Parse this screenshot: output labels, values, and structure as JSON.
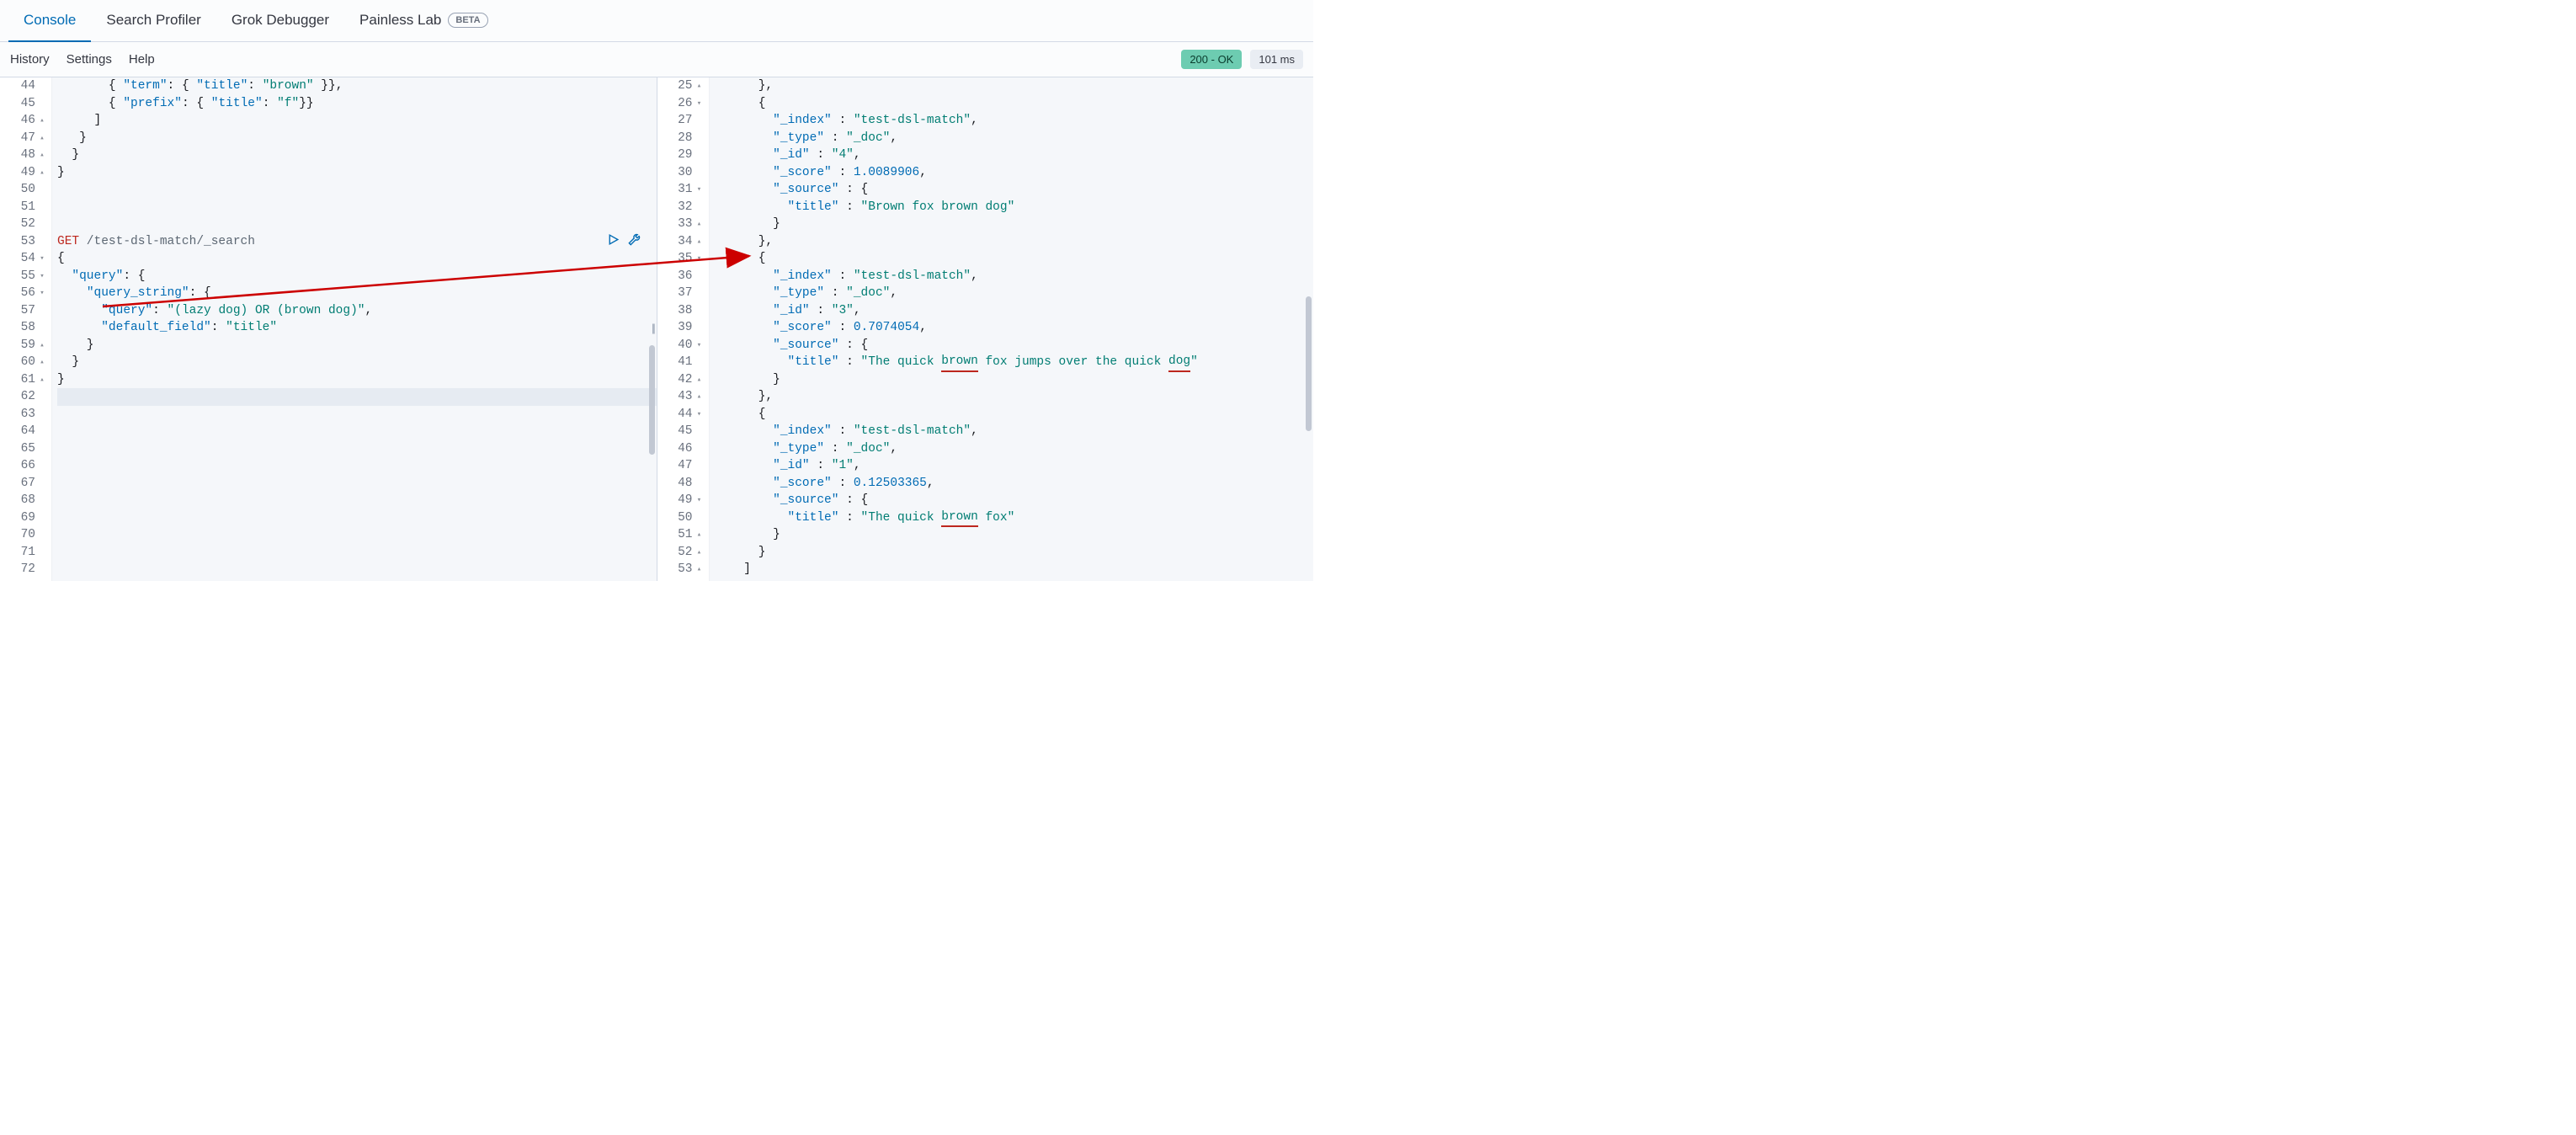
{
  "tabs": {
    "console": "Console",
    "search_profiler": "Search Profiler",
    "grok_debugger": "Grok Debugger",
    "painless_lab": "Painless Lab",
    "beta": "BETA"
  },
  "subbar": {
    "history": "History",
    "settings": "Settings",
    "help": "Help",
    "status": "200 - OK",
    "time": "101 ms"
  },
  "left": {
    "lines": [
      {
        "n": 44,
        "f": "",
        "seg": [
          {
            "t": "       { ",
            "c": "k-punc"
          },
          {
            "t": "\"term\"",
            "c": "k-key"
          },
          {
            "t": ": { ",
            "c": "k-punc"
          },
          {
            "t": "\"title\"",
            "c": "k-key"
          },
          {
            "t": ": ",
            "c": "k-punc"
          },
          {
            "t": "\"brown\"",
            "c": "k-str"
          },
          {
            "t": " }},",
            "c": "k-punc"
          }
        ]
      },
      {
        "n": 45,
        "f": "",
        "seg": [
          {
            "t": "       { ",
            "c": "k-punc"
          },
          {
            "t": "\"prefix\"",
            "c": "k-key"
          },
          {
            "t": ": { ",
            "c": "k-punc"
          },
          {
            "t": "\"title\"",
            "c": "k-key"
          },
          {
            "t": ": ",
            "c": "k-punc"
          },
          {
            "t": "\"f\"",
            "c": "k-str"
          },
          {
            "t": "}}",
            "c": "k-punc"
          }
        ]
      },
      {
        "n": 46,
        "f": "▴",
        "seg": [
          {
            "t": "     ]",
            "c": "k-punc"
          }
        ]
      },
      {
        "n": 47,
        "f": "▴",
        "seg": [
          {
            "t": "   }",
            "c": "k-punc"
          }
        ]
      },
      {
        "n": 48,
        "f": "▴",
        "seg": [
          {
            "t": "  }",
            "c": "k-punc"
          }
        ]
      },
      {
        "n": 49,
        "f": "▴",
        "seg": [
          {
            "t": "}",
            "c": "k-punc"
          }
        ]
      },
      {
        "n": 50,
        "f": "",
        "seg": []
      },
      {
        "n": 51,
        "f": "",
        "seg": []
      },
      {
        "n": 52,
        "f": "",
        "seg": []
      },
      {
        "n": 53,
        "f": "",
        "seg": [
          {
            "t": "GET",
            "c": "k-method"
          },
          {
            "t": " /test-dsl-match/_search",
            "c": "k-path"
          }
        ]
      },
      {
        "n": 54,
        "f": "▾",
        "seg": [
          {
            "t": "{",
            "c": "k-punc"
          }
        ]
      },
      {
        "n": 55,
        "f": "▾",
        "seg": [
          {
            "t": "  ",
            "c": ""
          },
          {
            "t": "\"query\"",
            "c": "k-key"
          },
          {
            "t": ": {",
            "c": "k-punc"
          }
        ]
      },
      {
        "n": 56,
        "f": "▾",
        "seg": [
          {
            "t": "    ",
            "c": ""
          },
          {
            "t": "\"query_string\"",
            "c": "k-key"
          },
          {
            "t": ": {",
            "c": "k-punc"
          }
        ]
      },
      {
        "n": 57,
        "f": "",
        "seg": [
          {
            "t": "      ",
            "c": ""
          },
          {
            "t": "\"query\"",
            "c": "k-key"
          },
          {
            "t": ": ",
            "c": "k-punc"
          },
          {
            "t": "\"(lazy dog) OR (brown dog)\"",
            "c": "k-str"
          },
          {
            "t": ",",
            "c": "k-punc"
          }
        ]
      },
      {
        "n": 58,
        "f": "",
        "seg": [
          {
            "t": "      ",
            "c": ""
          },
          {
            "t": "\"default_field\"",
            "c": "k-key"
          },
          {
            "t": ": ",
            "c": "k-punc"
          },
          {
            "t": "\"title\"",
            "c": "k-str"
          }
        ]
      },
      {
        "n": 59,
        "f": "▴",
        "seg": [
          {
            "t": "    }",
            "c": "k-punc"
          }
        ]
      },
      {
        "n": 60,
        "f": "▴",
        "seg": [
          {
            "t": "  }",
            "c": "k-punc"
          }
        ]
      },
      {
        "n": 61,
        "f": "▴",
        "seg": [
          {
            "t": "}",
            "c": "k-punc"
          }
        ]
      },
      {
        "n": 62,
        "f": "",
        "hl": true,
        "seg": []
      },
      {
        "n": 63,
        "f": "",
        "seg": []
      },
      {
        "n": 64,
        "f": "",
        "seg": []
      },
      {
        "n": 65,
        "f": "",
        "seg": []
      },
      {
        "n": 66,
        "f": "",
        "seg": []
      },
      {
        "n": 67,
        "f": "",
        "seg": []
      },
      {
        "n": 68,
        "f": "",
        "seg": []
      },
      {
        "n": 69,
        "f": "",
        "seg": []
      },
      {
        "n": 70,
        "f": "",
        "seg": []
      },
      {
        "n": 71,
        "f": "",
        "seg": []
      },
      {
        "n": 72,
        "f": "",
        "seg": []
      }
    ]
  },
  "right": {
    "lines": [
      {
        "n": 25,
        "f": "▴",
        "seg": [
          {
            "t": "      },",
            "c": "k-punc"
          }
        ]
      },
      {
        "n": 26,
        "f": "▾",
        "seg": [
          {
            "t": "      {",
            "c": "k-punc"
          }
        ]
      },
      {
        "n": 27,
        "f": "",
        "seg": [
          {
            "t": "        ",
            "c": ""
          },
          {
            "t": "\"_index\"",
            "c": "k-key"
          },
          {
            "t": " : ",
            "c": "k-punc"
          },
          {
            "t": "\"test-dsl-match\"",
            "c": "k-str"
          },
          {
            "t": ",",
            "c": "k-punc"
          }
        ]
      },
      {
        "n": 28,
        "f": "",
        "seg": [
          {
            "t": "        ",
            "c": ""
          },
          {
            "t": "\"_type\"",
            "c": "k-key"
          },
          {
            "t": " : ",
            "c": "k-punc"
          },
          {
            "t": "\"_doc\"",
            "c": "k-str"
          },
          {
            "t": ",",
            "c": "k-punc"
          }
        ]
      },
      {
        "n": 29,
        "f": "",
        "seg": [
          {
            "t": "        ",
            "c": ""
          },
          {
            "t": "\"_id\"",
            "c": "k-key"
          },
          {
            "t": " : ",
            "c": "k-punc"
          },
          {
            "t": "\"4\"",
            "c": "k-str"
          },
          {
            "t": ",",
            "c": "k-punc"
          }
        ]
      },
      {
        "n": 30,
        "f": "",
        "seg": [
          {
            "t": "        ",
            "c": ""
          },
          {
            "t": "\"_score\"",
            "c": "k-key"
          },
          {
            "t": " : ",
            "c": "k-punc"
          },
          {
            "t": "1.0089906",
            "c": "k-num"
          },
          {
            "t": ",",
            "c": "k-punc"
          }
        ]
      },
      {
        "n": 31,
        "f": "▾",
        "seg": [
          {
            "t": "        ",
            "c": ""
          },
          {
            "t": "\"_source\"",
            "c": "k-key"
          },
          {
            "t": " : {",
            "c": "k-punc"
          }
        ]
      },
      {
        "n": 32,
        "f": "",
        "seg": [
          {
            "t": "          ",
            "c": ""
          },
          {
            "t": "\"title\"",
            "c": "k-key"
          },
          {
            "t": " : ",
            "c": "k-punc"
          },
          {
            "t": "\"Brown fox brown dog\"",
            "c": "k-str"
          }
        ]
      },
      {
        "n": 33,
        "f": "▴",
        "seg": [
          {
            "t": "        }",
            "c": "k-punc"
          }
        ]
      },
      {
        "n": 34,
        "f": "▴",
        "seg": [
          {
            "t": "      },",
            "c": "k-punc"
          }
        ]
      },
      {
        "n": 35,
        "f": "▾",
        "seg": [
          {
            "t": "      {",
            "c": "k-punc"
          }
        ]
      },
      {
        "n": 36,
        "f": "",
        "seg": [
          {
            "t": "        ",
            "c": ""
          },
          {
            "t": "\"_index\"",
            "c": "k-key"
          },
          {
            "t": " : ",
            "c": "k-punc"
          },
          {
            "t": "\"test-dsl-match\"",
            "c": "k-str"
          },
          {
            "t": ",",
            "c": "k-punc"
          }
        ]
      },
      {
        "n": 37,
        "f": "",
        "seg": [
          {
            "t": "        ",
            "c": ""
          },
          {
            "t": "\"_type\"",
            "c": "k-key"
          },
          {
            "t": " : ",
            "c": "k-punc"
          },
          {
            "t": "\"_doc\"",
            "c": "k-str"
          },
          {
            "t": ",",
            "c": "k-punc"
          }
        ]
      },
      {
        "n": 38,
        "f": "",
        "seg": [
          {
            "t": "        ",
            "c": ""
          },
          {
            "t": "\"_id\"",
            "c": "k-key"
          },
          {
            "t": " : ",
            "c": "k-punc"
          },
          {
            "t": "\"3\"",
            "c": "k-str"
          },
          {
            "t": ",",
            "c": "k-punc"
          }
        ]
      },
      {
        "n": 39,
        "f": "",
        "seg": [
          {
            "t": "        ",
            "c": ""
          },
          {
            "t": "\"_score\"",
            "c": "k-key"
          },
          {
            "t": " : ",
            "c": "k-punc"
          },
          {
            "t": "0.7074054",
            "c": "k-num"
          },
          {
            "t": ",",
            "c": "k-punc"
          }
        ]
      },
      {
        "n": 40,
        "f": "▾",
        "seg": [
          {
            "t": "        ",
            "c": ""
          },
          {
            "t": "\"_source\"",
            "c": "k-key"
          },
          {
            "t": " : {",
            "c": "k-punc"
          }
        ]
      },
      {
        "n": 41,
        "f": "",
        "seg": [
          {
            "t": "          ",
            "c": ""
          },
          {
            "t": "\"title\"",
            "c": "k-key"
          },
          {
            "t": " : ",
            "c": "k-punc"
          },
          {
            "t": "\"The quick ",
            "c": "k-str"
          },
          {
            "t": "brown",
            "c": "k-str",
            "u": true
          },
          {
            "t": " fox jumps over the quick ",
            "c": "k-str"
          },
          {
            "t": "dog",
            "c": "k-str",
            "u": true
          },
          {
            "t": "\"",
            "c": "k-str"
          }
        ]
      },
      {
        "n": 42,
        "f": "▴",
        "seg": [
          {
            "t": "        }",
            "c": "k-punc"
          }
        ]
      },
      {
        "n": 43,
        "f": "▴",
        "seg": [
          {
            "t": "      },",
            "c": "k-punc"
          }
        ]
      },
      {
        "n": 44,
        "f": "▾",
        "seg": [
          {
            "t": "      {",
            "c": "k-punc"
          }
        ]
      },
      {
        "n": 45,
        "f": "",
        "seg": [
          {
            "t": "        ",
            "c": ""
          },
          {
            "t": "\"_index\"",
            "c": "k-key"
          },
          {
            "t": " : ",
            "c": "k-punc"
          },
          {
            "t": "\"test-dsl-match\"",
            "c": "k-str"
          },
          {
            "t": ",",
            "c": "k-punc"
          }
        ]
      },
      {
        "n": 46,
        "f": "",
        "seg": [
          {
            "t": "        ",
            "c": ""
          },
          {
            "t": "\"_type\"",
            "c": "k-key"
          },
          {
            "t": " : ",
            "c": "k-punc"
          },
          {
            "t": "\"_doc\"",
            "c": "k-str"
          },
          {
            "t": ",",
            "c": "k-punc"
          }
        ]
      },
      {
        "n": 47,
        "f": "",
        "seg": [
          {
            "t": "        ",
            "c": ""
          },
          {
            "t": "\"_id\"",
            "c": "k-key"
          },
          {
            "t": " : ",
            "c": "k-punc"
          },
          {
            "t": "\"1\"",
            "c": "k-str"
          },
          {
            "t": ",",
            "c": "k-punc"
          }
        ]
      },
      {
        "n": 48,
        "f": "",
        "seg": [
          {
            "t": "        ",
            "c": ""
          },
          {
            "t": "\"_score\"",
            "c": "k-key"
          },
          {
            "t": " : ",
            "c": "k-punc"
          },
          {
            "t": "0.12503365",
            "c": "k-num"
          },
          {
            "t": ",",
            "c": "k-punc"
          }
        ]
      },
      {
        "n": 49,
        "f": "▾",
        "seg": [
          {
            "t": "        ",
            "c": ""
          },
          {
            "t": "\"_source\"",
            "c": "k-key"
          },
          {
            "t": " : {",
            "c": "k-punc"
          }
        ]
      },
      {
        "n": 50,
        "f": "",
        "seg": [
          {
            "t": "          ",
            "c": ""
          },
          {
            "t": "\"title\"",
            "c": "k-key"
          },
          {
            "t": " : ",
            "c": "k-punc"
          },
          {
            "t": "\"The quick ",
            "c": "k-str"
          },
          {
            "t": "brown",
            "c": "k-str",
            "u": true
          },
          {
            "t": " fox\"",
            "c": "k-str"
          }
        ]
      },
      {
        "n": 51,
        "f": "▴",
        "seg": [
          {
            "t": "        }",
            "c": "k-punc"
          }
        ]
      },
      {
        "n": 52,
        "f": "▴",
        "seg": [
          {
            "t": "      }",
            "c": "k-punc"
          }
        ]
      },
      {
        "n": 53,
        "f": "▴",
        "seg": [
          {
            "t": "    ]",
            "c": "k-punc"
          }
        ]
      }
    ]
  }
}
